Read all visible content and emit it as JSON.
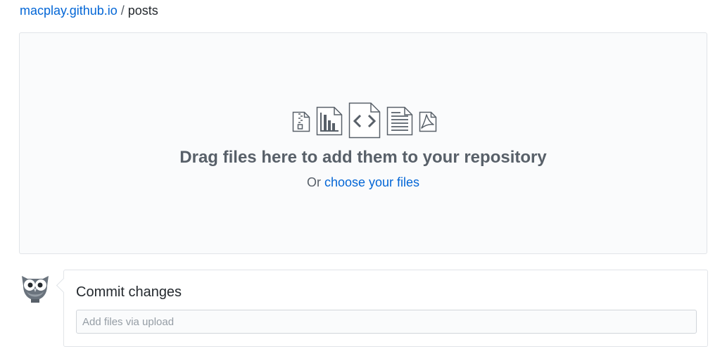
{
  "breadcrumb": {
    "repo": "macplay.github.io",
    "separator": "/",
    "path": "posts"
  },
  "dropzone": {
    "title": "Drag files here to add them to your repository",
    "prefix": "Or",
    "choose_link": "choose your files",
    "icons": [
      "file-zip-icon",
      "file-chart-icon",
      "file-code-icon",
      "file-text-icon",
      "file-pdf-icon"
    ]
  },
  "commit": {
    "title": "Commit changes",
    "placeholder": "Add files via upload",
    "value": ""
  },
  "colors": {
    "link": "#0366d6",
    "muted_text": "#586069",
    "dropzone_bg": "#fafbfc",
    "border": "#e1e4e8"
  }
}
